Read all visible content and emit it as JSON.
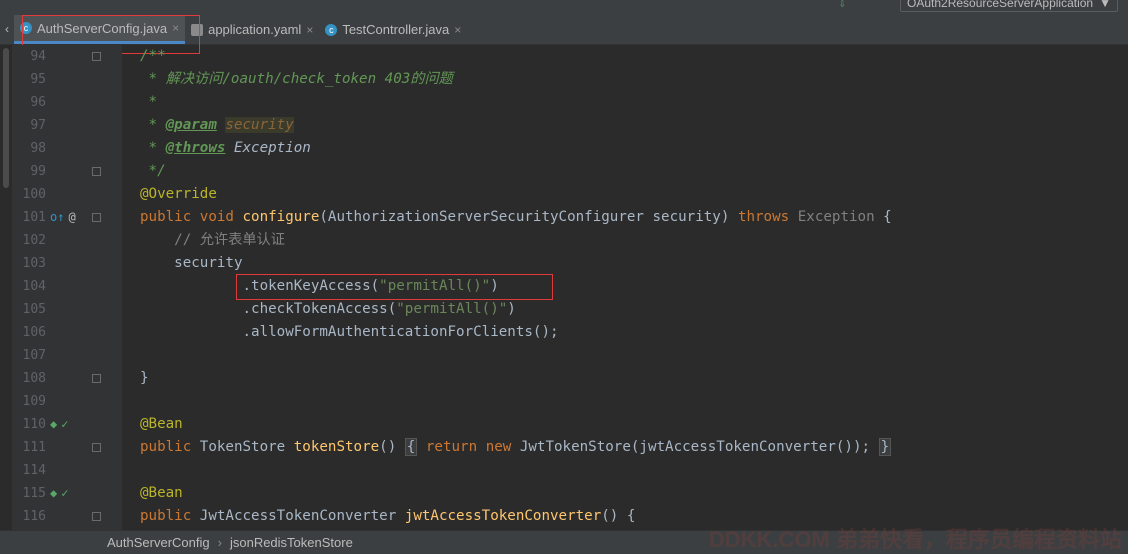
{
  "run_config": {
    "label": "OAuth2ResourceServerApplication",
    "arrow": "▼"
  },
  "tabs": [
    {
      "label": "AuthServerConfig.java",
      "icon": "java-class-icon",
      "icon_glyph": "c",
      "active": true
    },
    {
      "label": "application.yaml",
      "icon": "yaml-file-icon",
      "icon_glyph": "",
      "active": false
    },
    {
      "label": "TestController.java",
      "icon": "java-class-icon",
      "icon_glyph": "c",
      "active": false
    }
  ],
  "close_glyph": "×",
  "lines": [
    {
      "n": "94",
      "code": "/**"
    },
    {
      "n": "95",
      "code": " * 解决访问/oauth/check_token 403的问题"
    },
    {
      "n": "96",
      "code": " *"
    },
    {
      "n": "97",
      "code": " * @param security"
    },
    {
      "n": "98",
      "code": " * @throws Exception"
    },
    {
      "n": "99",
      "code": " */"
    },
    {
      "n": "100",
      "code": "@Override"
    },
    {
      "n": "101",
      "code": "public void configure(AuthorizationServerSecurityConfigurer security) throws Exception {"
    },
    {
      "n": "102",
      "code": "    // 允许表单认证"
    },
    {
      "n": "103",
      "code": "    security"
    },
    {
      "n": "104",
      "code": "            .tokenKeyAccess(\"permitAll()\")"
    },
    {
      "n": "105",
      "code": "            .checkTokenAccess(\"permitAll()\")"
    },
    {
      "n": "106",
      "code": "            .allowFormAuthenticationForClients();"
    },
    {
      "n": "107",
      "code": ""
    },
    {
      "n": "108",
      "code": "}"
    },
    {
      "n": "109",
      "code": ""
    },
    {
      "n": "110",
      "code": "@Bean"
    },
    {
      "n": "111",
      "code": "public TokenStore tokenStore() { return new JwtTokenStore(jwtAccessTokenConverter()); }"
    },
    {
      "n": "114",
      "code": ""
    },
    {
      "n": "115",
      "code": "@Bean"
    },
    {
      "n": "116",
      "code": "public JwtAccessTokenConverter jwtAccessTokenConverter() {"
    }
  ],
  "breadcrumb": [
    "AuthServerConfig",
    "jsonRedisTokenStore"
  ],
  "watermark": "DDKK.COM 弟弟快看，程序员编程资料站",
  "colors": {
    "keyword": "#cc7832",
    "string": "#6a8759",
    "annotation": "#bbb529",
    "method": "#ffc66d",
    "highlight": "#e03a3a"
  }
}
